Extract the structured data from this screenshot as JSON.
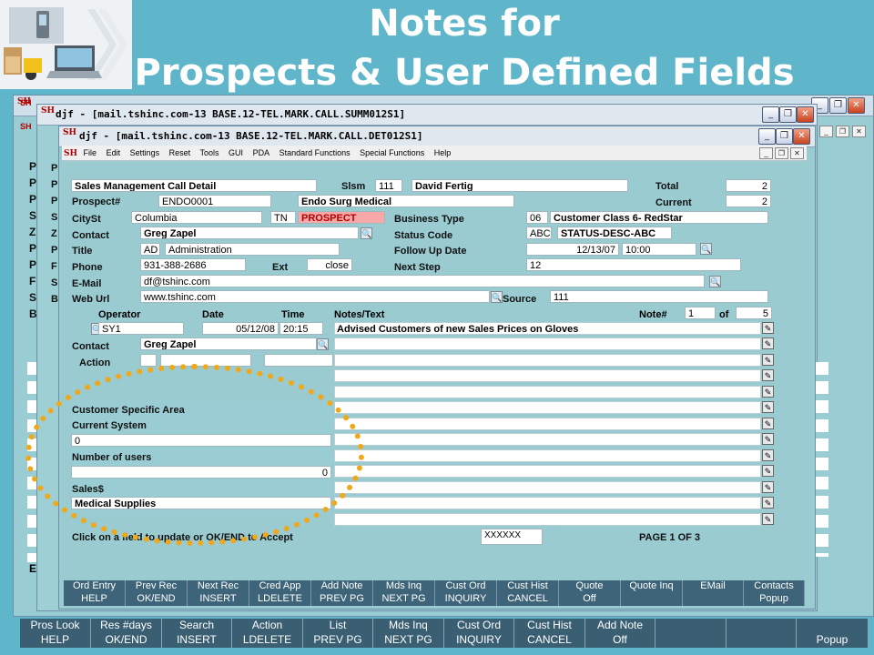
{
  "slide": {
    "title_line1": "Notes for",
    "title_line2": "Prospects & User Defined Fields"
  },
  "windows": {
    "back": {
      "title": ""
    },
    "summary": {
      "title": "djf - [mail.tshinc.com-13 BASE.12-TEL.MARK.CALL.SUMM012S1]"
    },
    "detail": {
      "title": "djf - [mail.tshinc.com-13 BASE.12-TEL.MARK.CALL.DET012S1]"
    },
    "app_icon_text": "SH",
    "controls": {
      "minimize": "_",
      "restore": "❐",
      "close": "✕"
    }
  },
  "menu": [
    "File",
    "Edit",
    "Settings",
    "Reset",
    "Tools",
    "GUI",
    "PDA",
    "Standard Functions",
    "Special Functions",
    "Help"
  ],
  "menu_controls": {
    "minimize": "_",
    "restore": "❐",
    "close": "✕"
  },
  "background_letters": [
    "P",
    "P",
    "P",
    "S",
    "Z",
    "P",
    "P",
    "F",
    "S",
    "B"
  ],
  "background_letters2": [
    "P",
    "P",
    "P",
    "S",
    "Z",
    "P",
    "F",
    "S",
    "B"
  ],
  "form": {
    "screen_title": "Sales Management Call Detail",
    "slsm_label": "Slsm",
    "slsm_code": "111",
    "slsm_name": "David Fertig",
    "total_label": "Total",
    "total_value": "2",
    "prospect_label": "Prospect#",
    "prospect_id": "ENDO0001",
    "prospect_name": "Endo Surg Medical",
    "current_label": "Current",
    "current_value": "2",
    "cityst_label": "CitySt",
    "city": "Columbia",
    "state": "TN",
    "status_flag": "PROSPECT",
    "business_type_label": "Business Type",
    "business_type_code": "06",
    "business_type_desc": "Customer Class 6- RedStar",
    "contact_label": "Contact",
    "contact_value": "Greg Zapel",
    "status_code_label": "Status Code",
    "status_code": "ABC",
    "status_desc": "STATUS-DESC-ABC",
    "title_label": "Title",
    "title_code": "AD",
    "title_desc": "Administration",
    "follow_up_label": "Follow Up Date",
    "follow_up_date": "12/13/07",
    "follow_up_time": "10:00",
    "phone_label": "Phone",
    "phone_value": "931-388-2686",
    "ext_label": "Ext",
    "ext_value": "close",
    "next_step_label": "Next Step",
    "next_step_value": "12",
    "email_label": "E-Mail",
    "email_value": "df@tshinc.com",
    "weburl_label": "Web Url",
    "weburl_value": "www.tshinc.com",
    "source_label": "Source",
    "source_value": "111",
    "lookup_icon": "🔍"
  },
  "notes": {
    "operator_label": "Operator",
    "date_label": "Date",
    "time_label": "Time",
    "notes_label": "Notes/Text",
    "note_num_label": "Note#",
    "note_num": "1",
    "of_label": "of",
    "note_total": "5",
    "operator_value": "SY1",
    "date_value": "05/12/08",
    "time_value": "20:15",
    "first_note": "Advised Customers of new Sales Prices on Gloves",
    "contact_label": "Contact",
    "contact_value": "Greg Zapel",
    "action_label": "Action",
    "note_button": "✎"
  },
  "udf": {
    "area_label": "Customer Specific Area",
    "current_system_label": "Current System",
    "current_system_value": "0",
    "num_users_label": "Number of users",
    "num_users_value": "0",
    "sales_label": "Sales$",
    "sales_value": "Medical Supplies"
  },
  "status_bar": {
    "message": "Click on a field to update or OK/END to Accept",
    "code": "XXXXXX",
    "page": "PAGE  1 OF  3"
  },
  "inner_fkeys_top": [
    "Ord Entry",
    "Prev Rec",
    "Next Rec",
    "Cred App",
    "Add Note",
    "Mds Inq",
    "Cust Ord",
    "Cust Hist",
    "Quote",
    "Quote Inq",
    "EMail",
    "Contacts"
  ],
  "inner_fkeys_bottom": [
    "HELP",
    "OK/END",
    "INSERT",
    "LDELETE",
    "PREV PG",
    "NEXT PG",
    "INQUIRY",
    "CANCEL",
    "Off",
    "",
    "",
    "Popup"
  ],
  "outer_fkeys_top": [
    "Pros Look",
    "Res #days",
    "Search",
    "Action",
    "List",
    "Mds Inq",
    "Cust Ord",
    "Cust Hist",
    "Add Note",
    "",
    "",
    ""
  ],
  "outer_fkeys_bottom": [
    "HELP",
    "OK/END",
    "INSERT",
    "LDELETE",
    "PREV PG",
    "NEXT PG",
    "INQUIRY",
    "CANCEL",
    "Off",
    "",
    "",
    "Popup"
  ],
  "background_side": {
    "letter_e": "E",
    "letter_en": "En",
    "letter_p": "P"
  }
}
